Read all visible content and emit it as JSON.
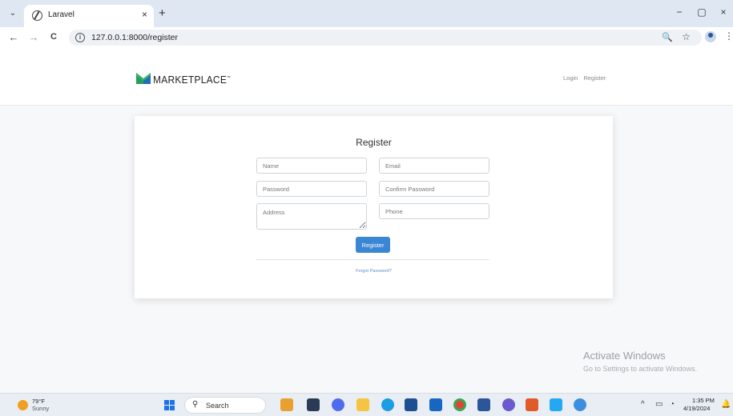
{
  "browser": {
    "tab_title": "Laravel",
    "url": "127.0.0.1:8000/register",
    "tab_list_glyph": "⌄",
    "tab_close_glyph": "×",
    "new_tab_glyph": "+",
    "back_glyph": "←",
    "forward_glyph": "→",
    "reload_glyph": "C",
    "zoom_glyph": "🔍",
    "star_glyph": "☆",
    "menu_glyph": "⋮",
    "minimize_glyph": "−",
    "restore_glyph": "▢",
    "close_glyph": "×"
  },
  "site": {
    "logo_text": "MARKETPLACE",
    "logo_mark": "™",
    "nav": {
      "login": "Login",
      "register": "Register"
    },
    "brand_colors": {
      "left": "#2a9d5c",
      "right": "#1f6fb8"
    }
  },
  "form": {
    "title": "Register",
    "name_placeholder": "Name",
    "email_placeholder": "Email",
    "password_placeholder": "Password",
    "confirm_password_placeholder": "Confirm Password",
    "address_placeholder": "Address",
    "phone_placeholder": "Phone",
    "submit_label": "Register",
    "forgot_link": "Forgot Password?"
  },
  "watermark": {
    "title": "Activate Windows",
    "subtitle": "Go to Settings to activate Windows."
  },
  "taskbar": {
    "weather_temp": "79°F",
    "weather_condition": "Sunny",
    "search_label": "Search",
    "search_glyph": "⚲",
    "time": "1:35 PM",
    "date": "4/19/2024",
    "tray_chevron": "^",
    "bell_glyph": "🔔"
  }
}
